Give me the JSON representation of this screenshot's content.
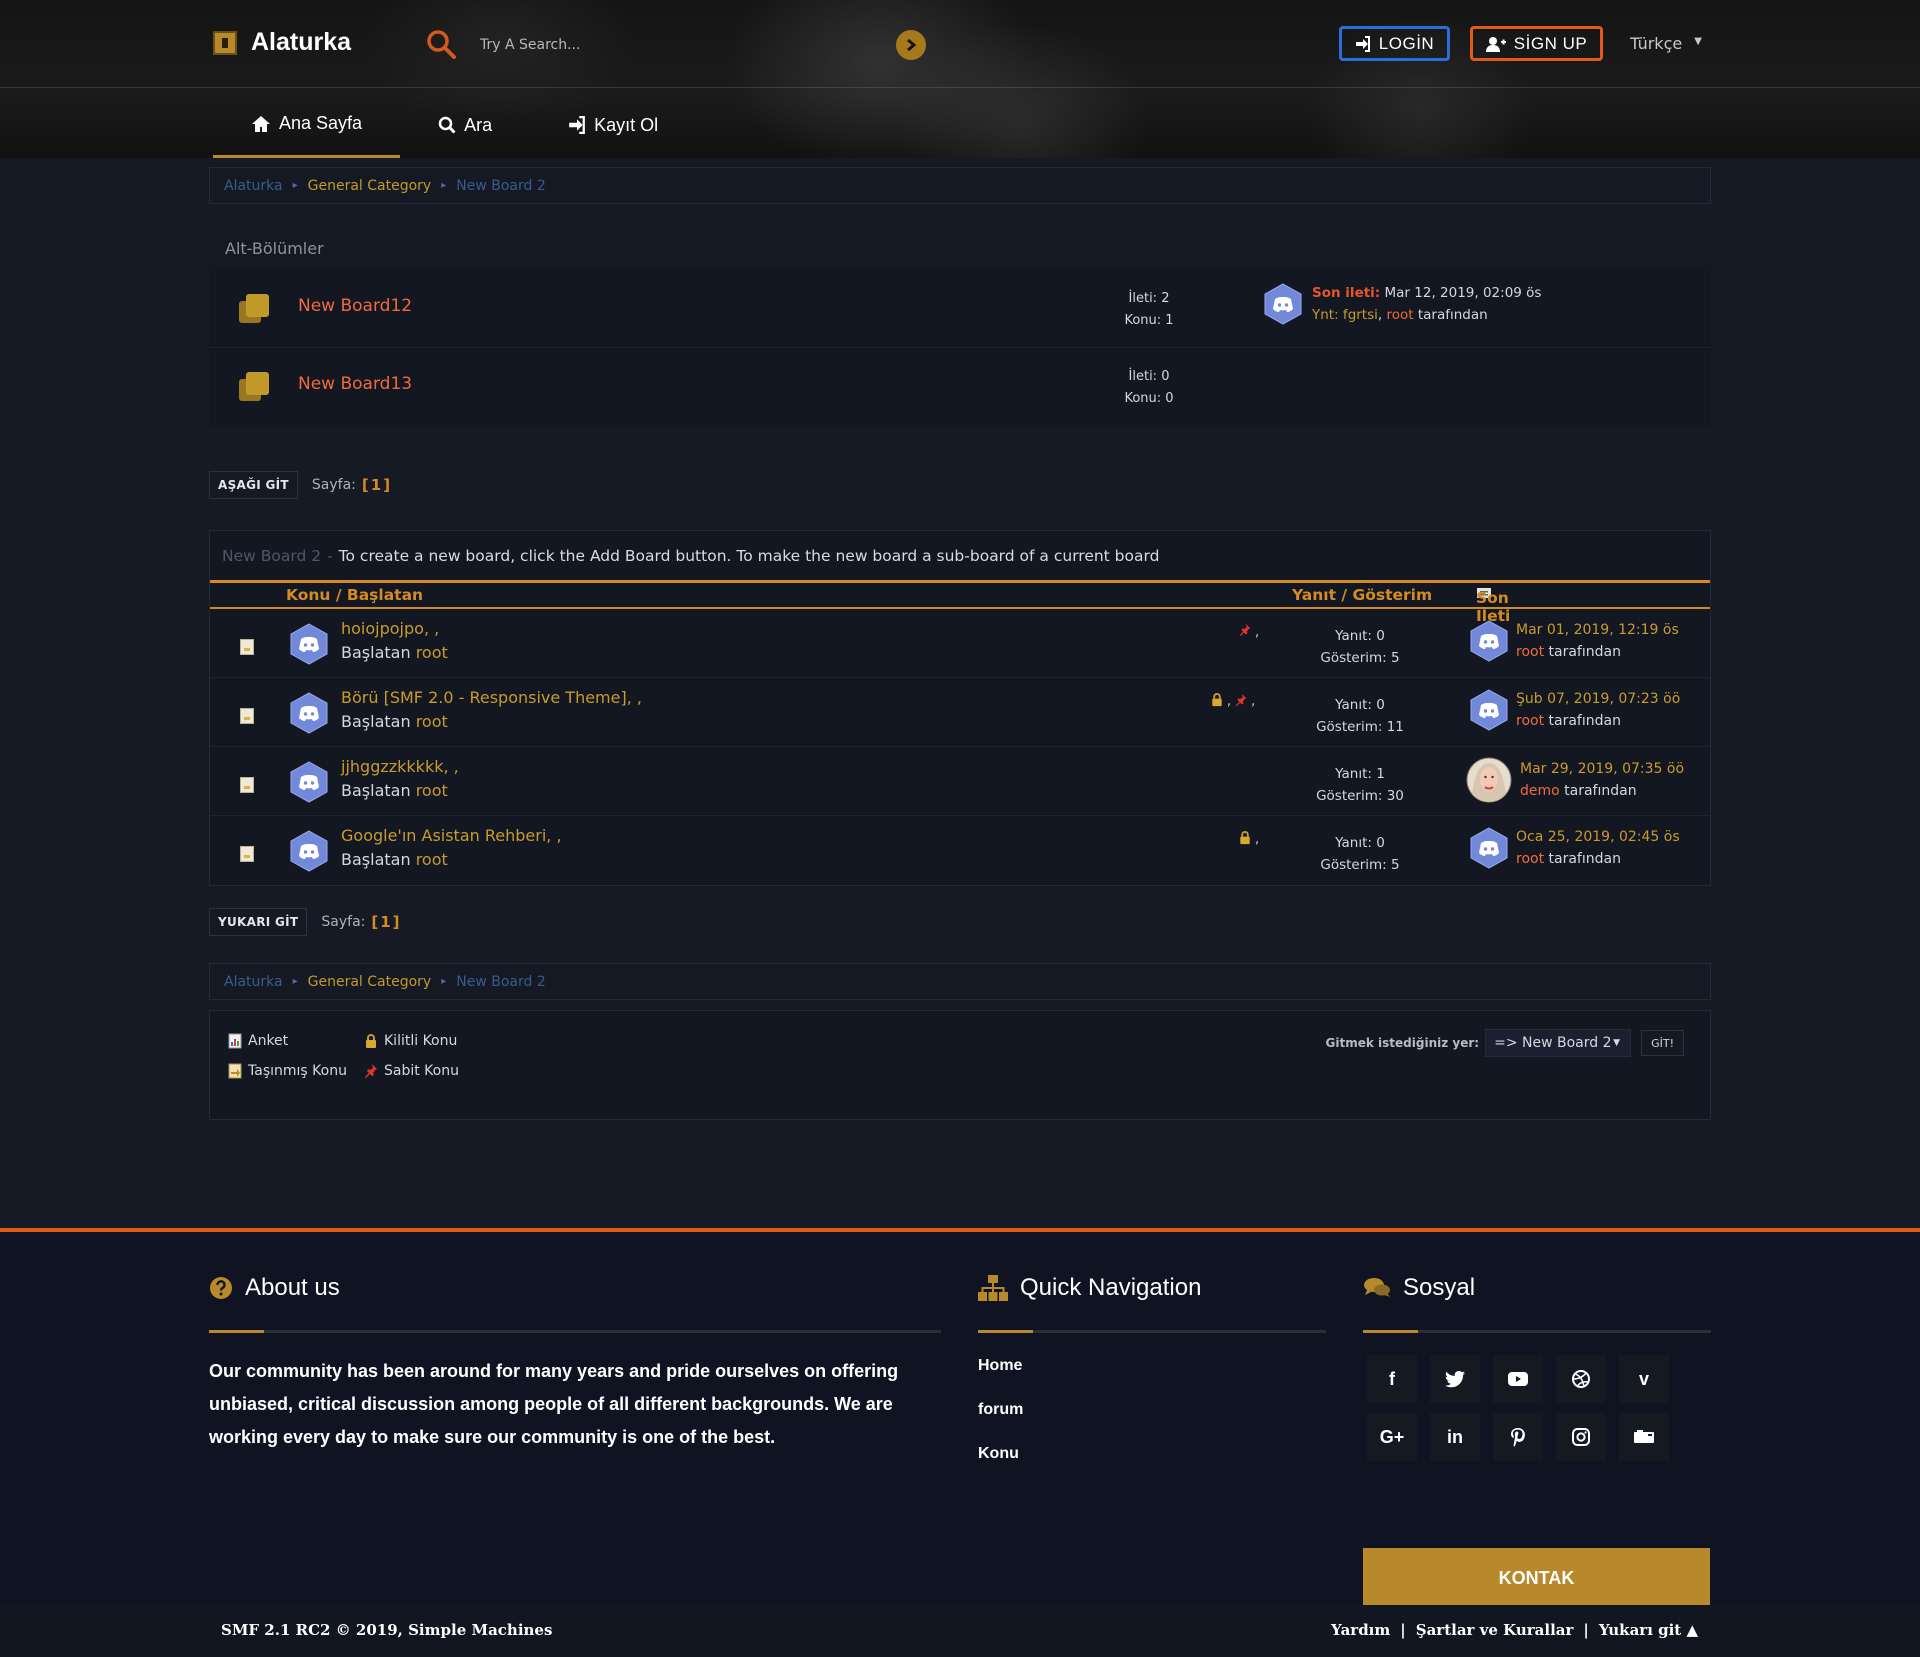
{
  "header": {
    "site_name": "Alaturka",
    "search_placeholder": "Try A Search...",
    "login_label": "LOGİN",
    "signup_label": "SİGN UP",
    "language": "Türkçe",
    "nav": [
      {
        "label": "Ana Sayfa",
        "icon": "home-icon",
        "active": true
      },
      {
        "label": "Ara",
        "icon": "search-icon",
        "active": false
      },
      {
        "label": "Kayıt Ol",
        "icon": "sign-in-icon",
        "active": false
      }
    ]
  },
  "breadcrumb": {
    "root": "Alaturka",
    "category": "General Category",
    "current": "New Board 2",
    "separator": "▸"
  },
  "subboards": {
    "title": "Alt-Bölümler",
    "rows": [
      {
        "name": "New Board12",
        "posts": "İleti: 2",
        "topics": "Konu: 1",
        "last_label": "Son ileti:",
        "last_date": "Mar 12, 2019, 02:09 ös",
        "last_topic": "Ynt: fgrtsi",
        "last_user": "root",
        "last_suffix": "tarafından"
      },
      {
        "name": "New Board13",
        "posts": "İleti: 0",
        "topics": "Konu: 0"
      }
    ]
  },
  "pager_top": {
    "button": "AŞAĞI GİT",
    "label": "Sayfa:",
    "pages": "[1]"
  },
  "pager_bottom": {
    "button": "YUKARI GİT",
    "label": "Sayfa:",
    "pages": "[1]"
  },
  "topic_list": {
    "board_name": "New Board 2",
    "board_dash": "-",
    "description": "To create a new board, click the Add Board button. To make the new board a sub-board of a current board",
    "col_subject": "Konu / Başlatan",
    "col_replies": "Yanıt / Gösterim",
    "col_last": "Son İleti",
    "topics": [
      {
        "title": "hoiojpojpo, ,",
        "by_label": "Başlatan",
        "starter": "root",
        "pinned": true,
        "locked": false,
        "icon_suffix": ",",
        "replies": "Yanıt: 0",
        "views": "Gösterim: 5",
        "last_date": "Mar 01, 2019, 12:19 ös",
        "last_user": "root",
        "last_suffix": "tarafından",
        "avatar": "discord"
      },
      {
        "title": "Börü [SMF 2.0 - Responsive Theme], ,",
        "by_label": "Başlatan",
        "starter": "root",
        "pinned": true,
        "locked": true,
        "icon_suffix": ",",
        "replies": "Yanıt: 0",
        "views": "Gösterim: 11",
        "last_date": "Şub 07, 2019, 07:23 öö",
        "last_user": "root",
        "last_suffix": "tarafından",
        "avatar": "discord"
      },
      {
        "title": "jjhggzzkkkkk, ,",
        "by_label": "Başlatan",
        "starter": "root",
        "pinned": false,
        "locked": false,
        "icon_suffix": "",
        "replies": "Yanıt: 1",
        "views": "Gösterim: 30",
        "last_date": "Mar 29, 2019, 07:35 öö",
        "last_user": "demo",
        "last_suffix": "tarafından",
        "avatar": "photo"
      },
      {
        "title": "Google'ın Asistan Rehberi, ,",
        "by_label": "Başlatan",
        "starter": "root",
        "pinned": false,
        "locked": true,
        "icon_suffix": ",",
        "replies": "Yanıt: 0",
        "views": "Gösterim: 5",
        "last_date": "Oca 25, 2019, 02:45 ös",
        "last_user": "root",
        "last_suffix": "tarafından",
        "avatar": "discord"
      }
    ]
  },
  "legend": {
    "poll": "Anket",
    "locked": "Kilitli Konu",
    "moved": "Taşınmış Konu",
    "sticky": "Sabit Konu",
    "jump_label": "Gitmek istediğiniz yer:",
    "jump_value": "=> New Board 2",
    "go_button": "GİT!"
  },
  "footer": {
    "about_title": "About us",
    "about_text": "Our community has been around for many years and pride ourselves on offering unbiased, critical discussion among people of all different backgrounds. We are working every day to make sure our community is one of the best.",
    "quick_title": "Quick Navigation",
    "quick_links": [
      "Home",
      "forum",
      "Konu"
    ],
    "social_title": "Sosyal",
    "social": [
      "facebook-icon",
      "twitter-icon",
      "youtube-icon",
      "dribbble-icon",
      "vimeo-icon",
      "google-plus-icon",
      "linkedin-icon",
      "pinterest-icon",
      "instagram-icon",
      "flickr-icon"
    ],
    "contact_button": "KONTAK",
    "copyright": "SMF 2.1 RC2 © 2019, Simple Machines",
    "bottom_links": [
      "Yardım",
      "Şartlar ve Kurallar",
      "Yukarı git ▲"
    ]
  },
  "colors": {
    "accent_gold": "#b7892a",
    "accent_orange": "#e25a17",
    "link_orange": "#ef6a3c",
    "login_blue": "#2a6ddc",
    "discord_blue": "#7289da"
  }
}
